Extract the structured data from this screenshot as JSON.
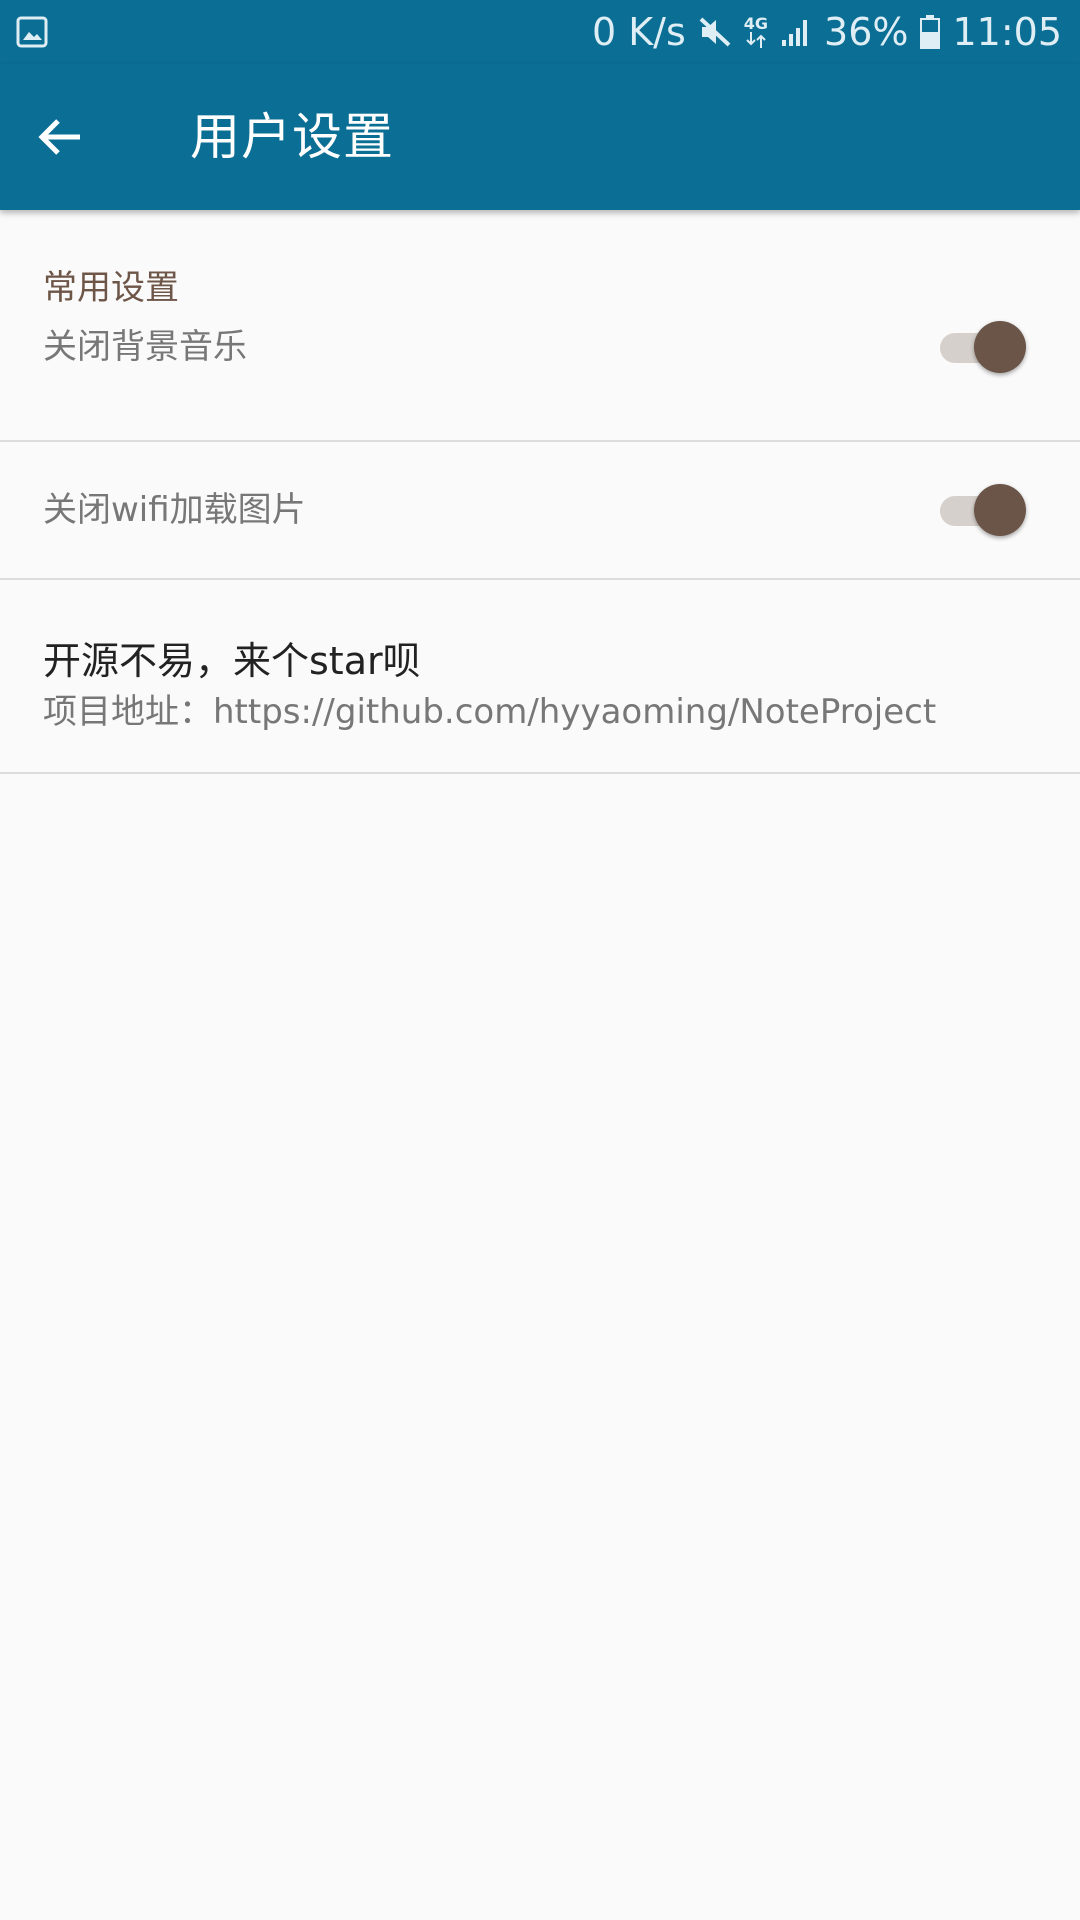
{
  "status_bar": {
    "net_speed": "0 K/s",
    "network_type": "4G",
    "battery": "36%",
    "time": "11:05",
    "icons": [
      "gallery-icon",
      "mute-icon",
      "4g-data-icon",
      "signal-icon",
      "battery-icon"
    ]
  },
  "toolbar": {
    "title": "用户设置",
    "back_icon": "arrow-back-icon",
    "background_color": "#0b6f95"
  },
  "settings": {
    "section_header": "常用设置",
    "items": [
      {
        "label": "关闭背景音乐",
        "switch_on": true
      },
      {
        "label": "关闭wifi加载图片",
        "switch_on": true
      }
    ],
    "star": {
      "title": "开源不易，来个star呗",
      "subtitle": "项目地址：https://github.com/hyyaoming/NoteProject"
    }
  },
  "colors": {
    "accent": "#6b5448",
    "switch_track": "#d6d0cc",
    "section_header": "#6d5548"
  }
}
